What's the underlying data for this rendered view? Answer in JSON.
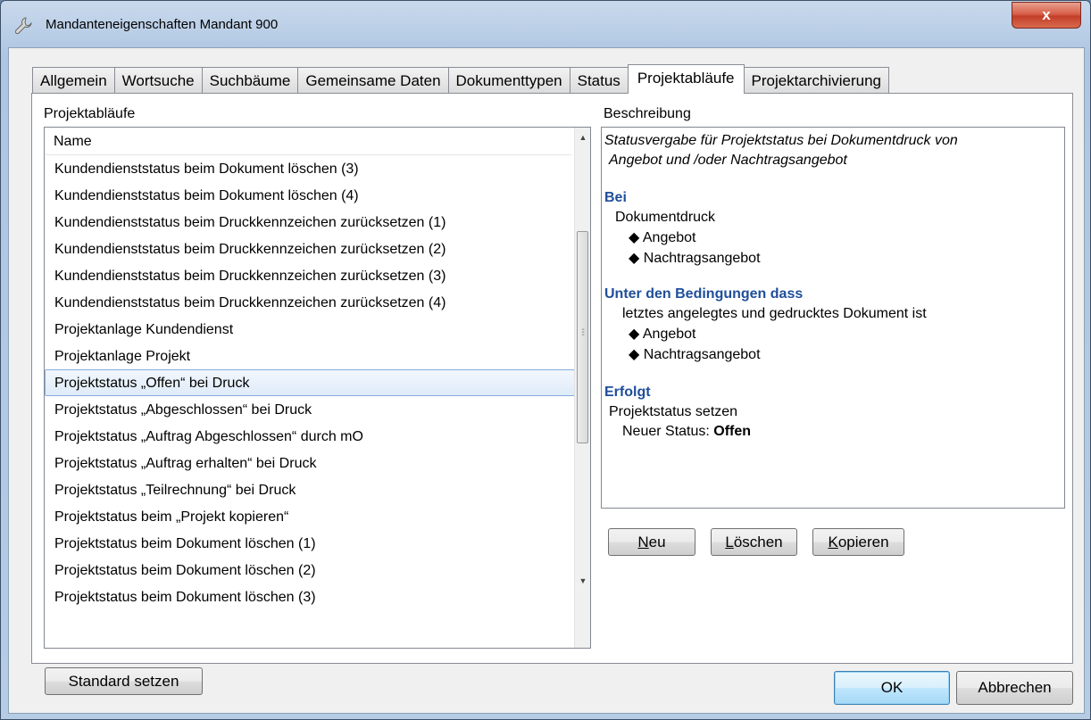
{
  "window": {
    "title": "Mandanteneigenschaften Mandant 900",
    "close_label": "x"
  },
  "tabs": [
    {
      "label": "Allgemein"
    },
    {
      "label": "Wortsuche"
    },
    {
      "label": "Suchbäume"
    },
    {
      "label": "Gemeinsame Daten"
    },
    {
      "label": "Dokumenttypen"
    },
    {
      "label": "Status"
    },
    {
      "label": "Projektabläufe",
      "active": true
    },
    {
      "label": "Projektarchivierung"
    }
  ],
  "left": {
    "group_label": "Projektabläufe",
    "column_header": "Name",
    "selected_index": 8,
    "items": [
      "Kundendienststatus beim Dokument löschen (3)",
      "Kundendienststatus beim Dokument löschen (4)",
      "Kundendienststatus beim Druckkennzeichen zurücksetzen (1)",
      "Kundendienststatus beim Druckkennzeichen zurücksetzen (2)",
      "Kundendienststatus beim Druckkennzeichen zurücksetzen (3)",
      "Kundendienststatus beim Druckkennzeichen zurücksetzen (4)",
      "Projektanlage Kundendienst",
      "Projektanlage Projekt",
      "Projektstatus  „Offen“ bei Druck",
      "Projektstatus „Abgeschlossen“ bei Druck",
      "Projektstatus „Auftrag Abgeschlossen“ durch mO",
      "Projektstatus „Auftrag erhalten“ bei Druck",
      "Projektstatus „Teilrechnung“ bei Druck",
      "Projektstatus beim „Projekt kopieren“",
      "Projektstatus beim Dokument löschen (1)",
      "Projektstatus beim Dokument löschen (2)",
      "Projektstatus beim Dokument löschen (3)"
    ],
    "standard_button": "Standard setzen"
  },
  "right": {
    "group_label": "Beschreibung",
    "intro_line1": "Statusvergabe für Projektstatus bei Dokumentdruck von",
    "intro_line2": "Angebot und /oder Nachtragsangebot",
    "bei_heading": "Bei",
    "bei_text": "Dokumentdruck",
    "bei_items": [
      "Angebot",
      "Nachtragsangebot"
    ],
    "cond_heading": "Unter den Bedingungen dass",
    "cond_text": "letztes angelegtes und gedrucktes Dokument ist",
    "cond_items": [
      "Angebot",
      "Nachtragsangebot"
    ],
    "erfolgt_heading": "Erfolgt",
    "erfolgt_text": "Projektstatus setzen",
    "status_label": "Neuer Status:",
    "status_value": "Offen",
    "buttons": {
      "neu_hotkey": "N",
      "neu_rest": "eu",
      "loeschen_hotkey": "L",
      "loeschen_rest": "öschen",
      "kopieren_hotkey": "K",
      "kopieren_rest": "opieren"
    }
  },
  "footer": {
    "ok_label": "OK",
    "cancel_label": "Abbrechen"
  },
  "colors": {
    "heading_blue": "#1f4e9a",
    "selection_border": "#84acdd"
  }
}
